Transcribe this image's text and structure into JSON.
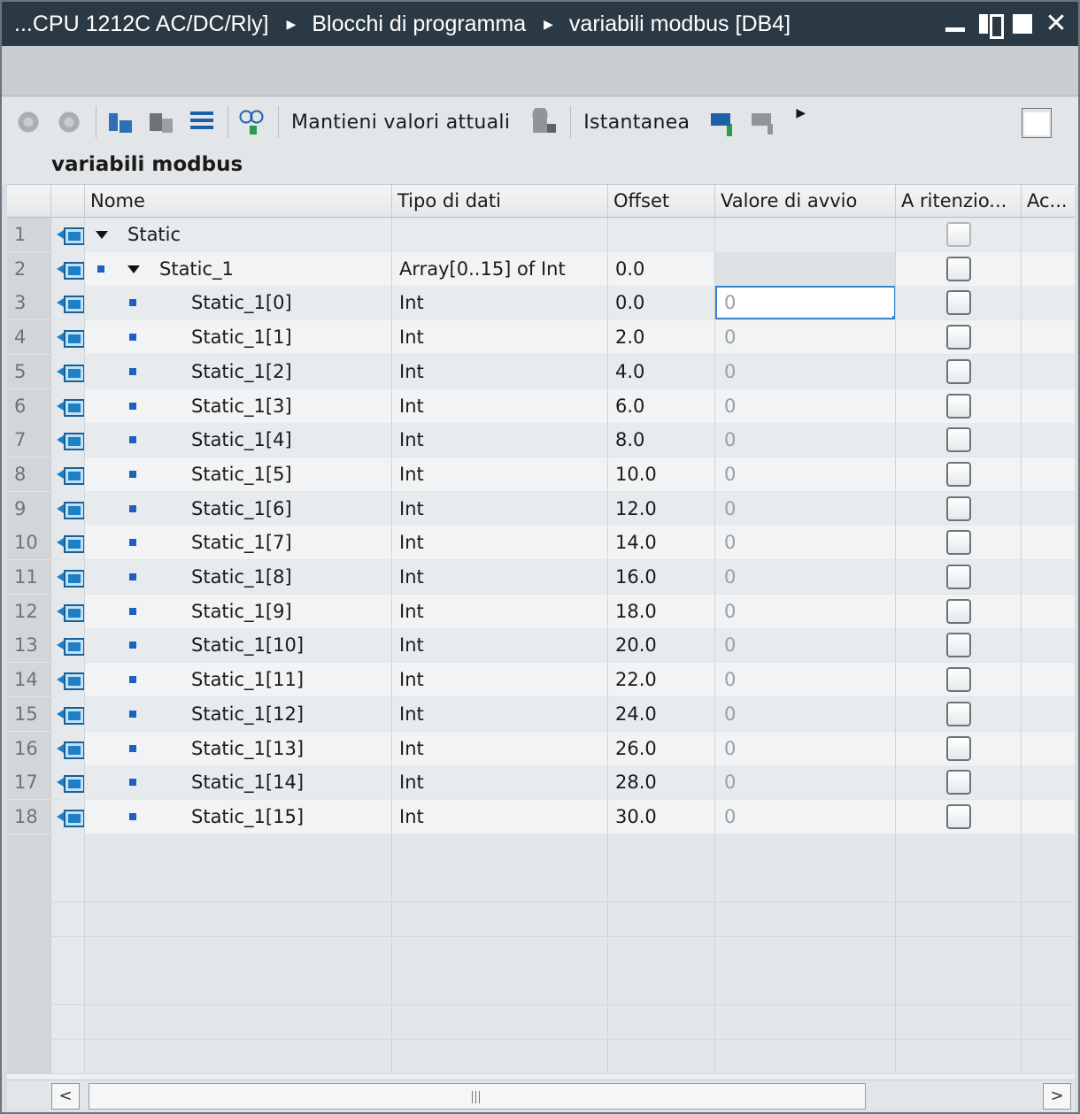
{
  "window": {
    "breadcrumbs": [
      "...CPU 1212C AC/DC/Rly]",
      "Blocchi di programma",
      "variabili modbus [DB4]"
    ],
    "controls": [
      "minimize-icon",
      "float-icon",
      "maximize-icon",
      "close-icon"
    ]
  },
  "toolbar": {
    "keep_values_label": "Mantieni valori attuali",
    "snapshot_label": "Istantanea",
    "icons": [
      "insert-row-icon",
      "add-row-icon",
      "expanded-mode-icon",
      "update-interface-icon",
      "list-view-icon",
      "monitor-all-icon",
      "database-icon",
      "load-snapshot-icon",
      "copy-snapshot-icon",
      "more-icon",
      "block-properties-icon"
    ]
  },
  "block_title": "variabili modbus",
  "columns": {
    "name": "Nome",
    "datatype": "Tipo di dati",
    "offset": "Offset",
    "start_value": "Valore di avvio",
    "retain": "A ritenzio...",
    "access": "Ac..."
  },
  "rows": [
    {
      "num": "1",
      "name": "Static",
      "type": "",
      "offset": "",
      "start": ""
    },
    {
      "num": "2",
      "name": "Static_1",
      "type": "Array[0..15] of Int",
      "offset": "0.0",
      "start": ""
    },
    {
      "num": "3",
      "name": "Static_1[0]",
      "type": "Int",
      "offset": "0.0",
      "start": "0"
    },
    {
      "num": "4",
      "name": "Static_1[1]",
      "type": "Int",
      "offset": "2.0",
      "start": "0"
    },
    {
      "num": "5",
      "name": "Static_1[2]",
      "type": "Int",
      "offset": "4.0",
      "start": "0"
    },
    {
      "num": "6",
      "name": "Static_1[3]",
      "type": "Int",
      "offset": "6.0",
      "start": "0"
    },
    {
      "num": "7",
      "name": "Static_1[4]",
      "type": "Int",
      "offset": "8.0",
      "start": "0"
    },
    {
      "num": "8",
      "name": "Static_1[5]",
      "type": "Int",
      "offset": "10.0",
      "start": "0"
    },
    {
      "num": "9",
      "name": "Static_1[6]",
      "type": "Int",
      "offset": "12.0",
      "start": "0"
    },
    {
      "num": "10",
      "name": "Static_1[7]",
      "type": "Int",
      "offset": "14.0",
      "start": "0"
    },
    {
      "num": "11",
      "name": "Static_1[8]",
      "type": "Int",
      "offset": "16.0",
      "start": "0"
    },
    {
      "num": "12",
      "name": "Static_1[9]",
      "type": "Int",
      "offset": "18.0",
      "start": "0"
    },
    {
      "num": "13",
      "name": "Static_1[10]",
      "type": "Int",
      "offset": "20.0",
      "start": "0"
    },
    {
      "num": "14",
      "name": "Static_1[11]",
      "type": "Int",
      "offset": "22.0",
      "start": "0"
    },
    {
      "num": "15",
      "name": "Static_1[12]",
      "type": "Int",
      "offset": "24.0",
      "start": "0"
    },
    {
      "num": "16",
      "name": "Static_1[13]",
      "type": "Int",
      "offset": "26.0",
      "start": "0"
    },
    {
      "num": "17",
      "name": "Static_1[14]",
      "type": "Int",
      "offset": "28.0",
      "start": "0"
    },
    {
      "num": "18",
      "name": "Static_1[15]",
      "type": "Int",
      "offset": "30.0",
      "start": "0"
    }
  ],
  "scrollbar": {
    "left": "<",
    "right": ">"
  },
  "colors": {
    "titlebar": "#2a3944",
    "accent": "#3b83d1",
    "tag_icon": "#1f7fc4",
    "bullet": "#1f5fbf"
  }
}
